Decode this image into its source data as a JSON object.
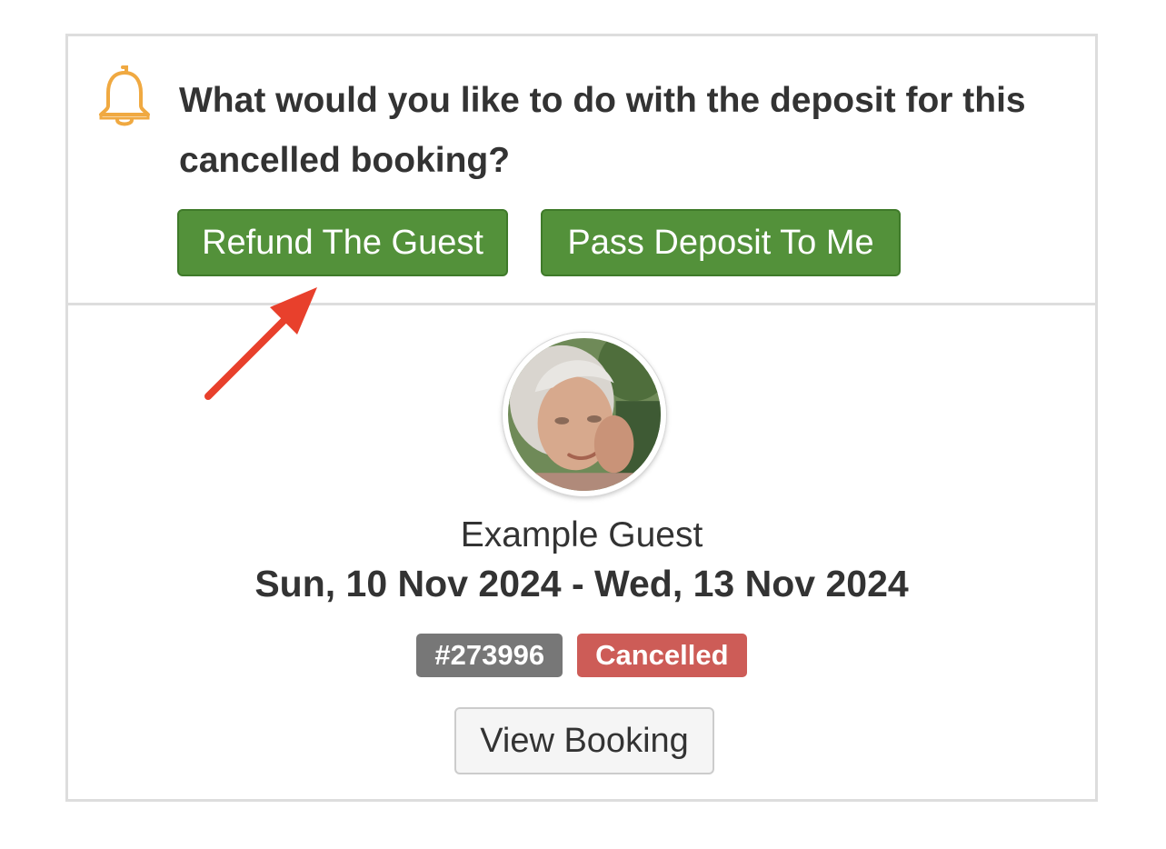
{
  "notice": {
    "icon": "bell-icon",
    "icon_color": "#f0a941",
    "question": "What would you like to do with the deposit for this cancelled booking?",
    "refund_label": "Refund The Guest",
    "pass_label": "Pass Deposit To Me",
    "button_color": "#53913a",
    "annotation_arrow_color": "#e8402c"
  },
  "booking": {
    "guest_name": "Example Guest",
    "dates": "Sun, 10 Nov 2024 - Wed, 13 Nov 2024",
    "booking_id": "#273996",
    "status": "Cancelled",
    "status_color": "#cd5c57",
    "view_label": "View Booking"
  }
}
